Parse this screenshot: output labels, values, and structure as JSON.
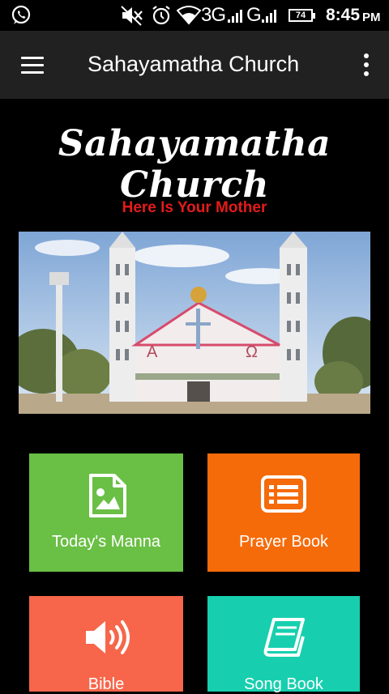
{
  "status_bar": {
    "network_3g": "3G",
    "network_g": "G",
    "battery": "74",
    "time": "8:45",
    "ampm": "PM",
    "icons": [
      "whatsapp-icon",
      "mute-icon",
      "alarm-icon",
      "wifi-icon",
      "signal-icon",
      "battery-icon"
    ]
  },
  "appbar": {
    "title": "Sahayamatha Church",
    "icons": [
      "hamburger-menu-icon",
      "more-vert-icon"
    ]
  },
  "hero": {
    "title": "Sahayamatha Church",
    "tagline": "Here Is Your Mother"
  },
  "photo": {
    "letter_alpha": "A",
    "letter_omega": "Ω"
  },
  "tiles": [
    {
      "label": "Today's Manna",
      "color": "#6abf45",
      "icon": "image-file-icon"
    },
    {
      "label": "Prayer Book",
      "color": "#f56b0a",
      "icon": "list-icon"
    },
    {
      "label": "Bible",
      "color": "#f7664a",
      "icon": "speaker-icon"
    },
    {
      "label": "Song Book",
      "color": "#17cfae",
      "icon": "book-icon"
    }
  ],
  "colors": {
    "appbar": "#212121",
    "tagline": "#e41b1b",
    "background": "#000000"
  }
}
